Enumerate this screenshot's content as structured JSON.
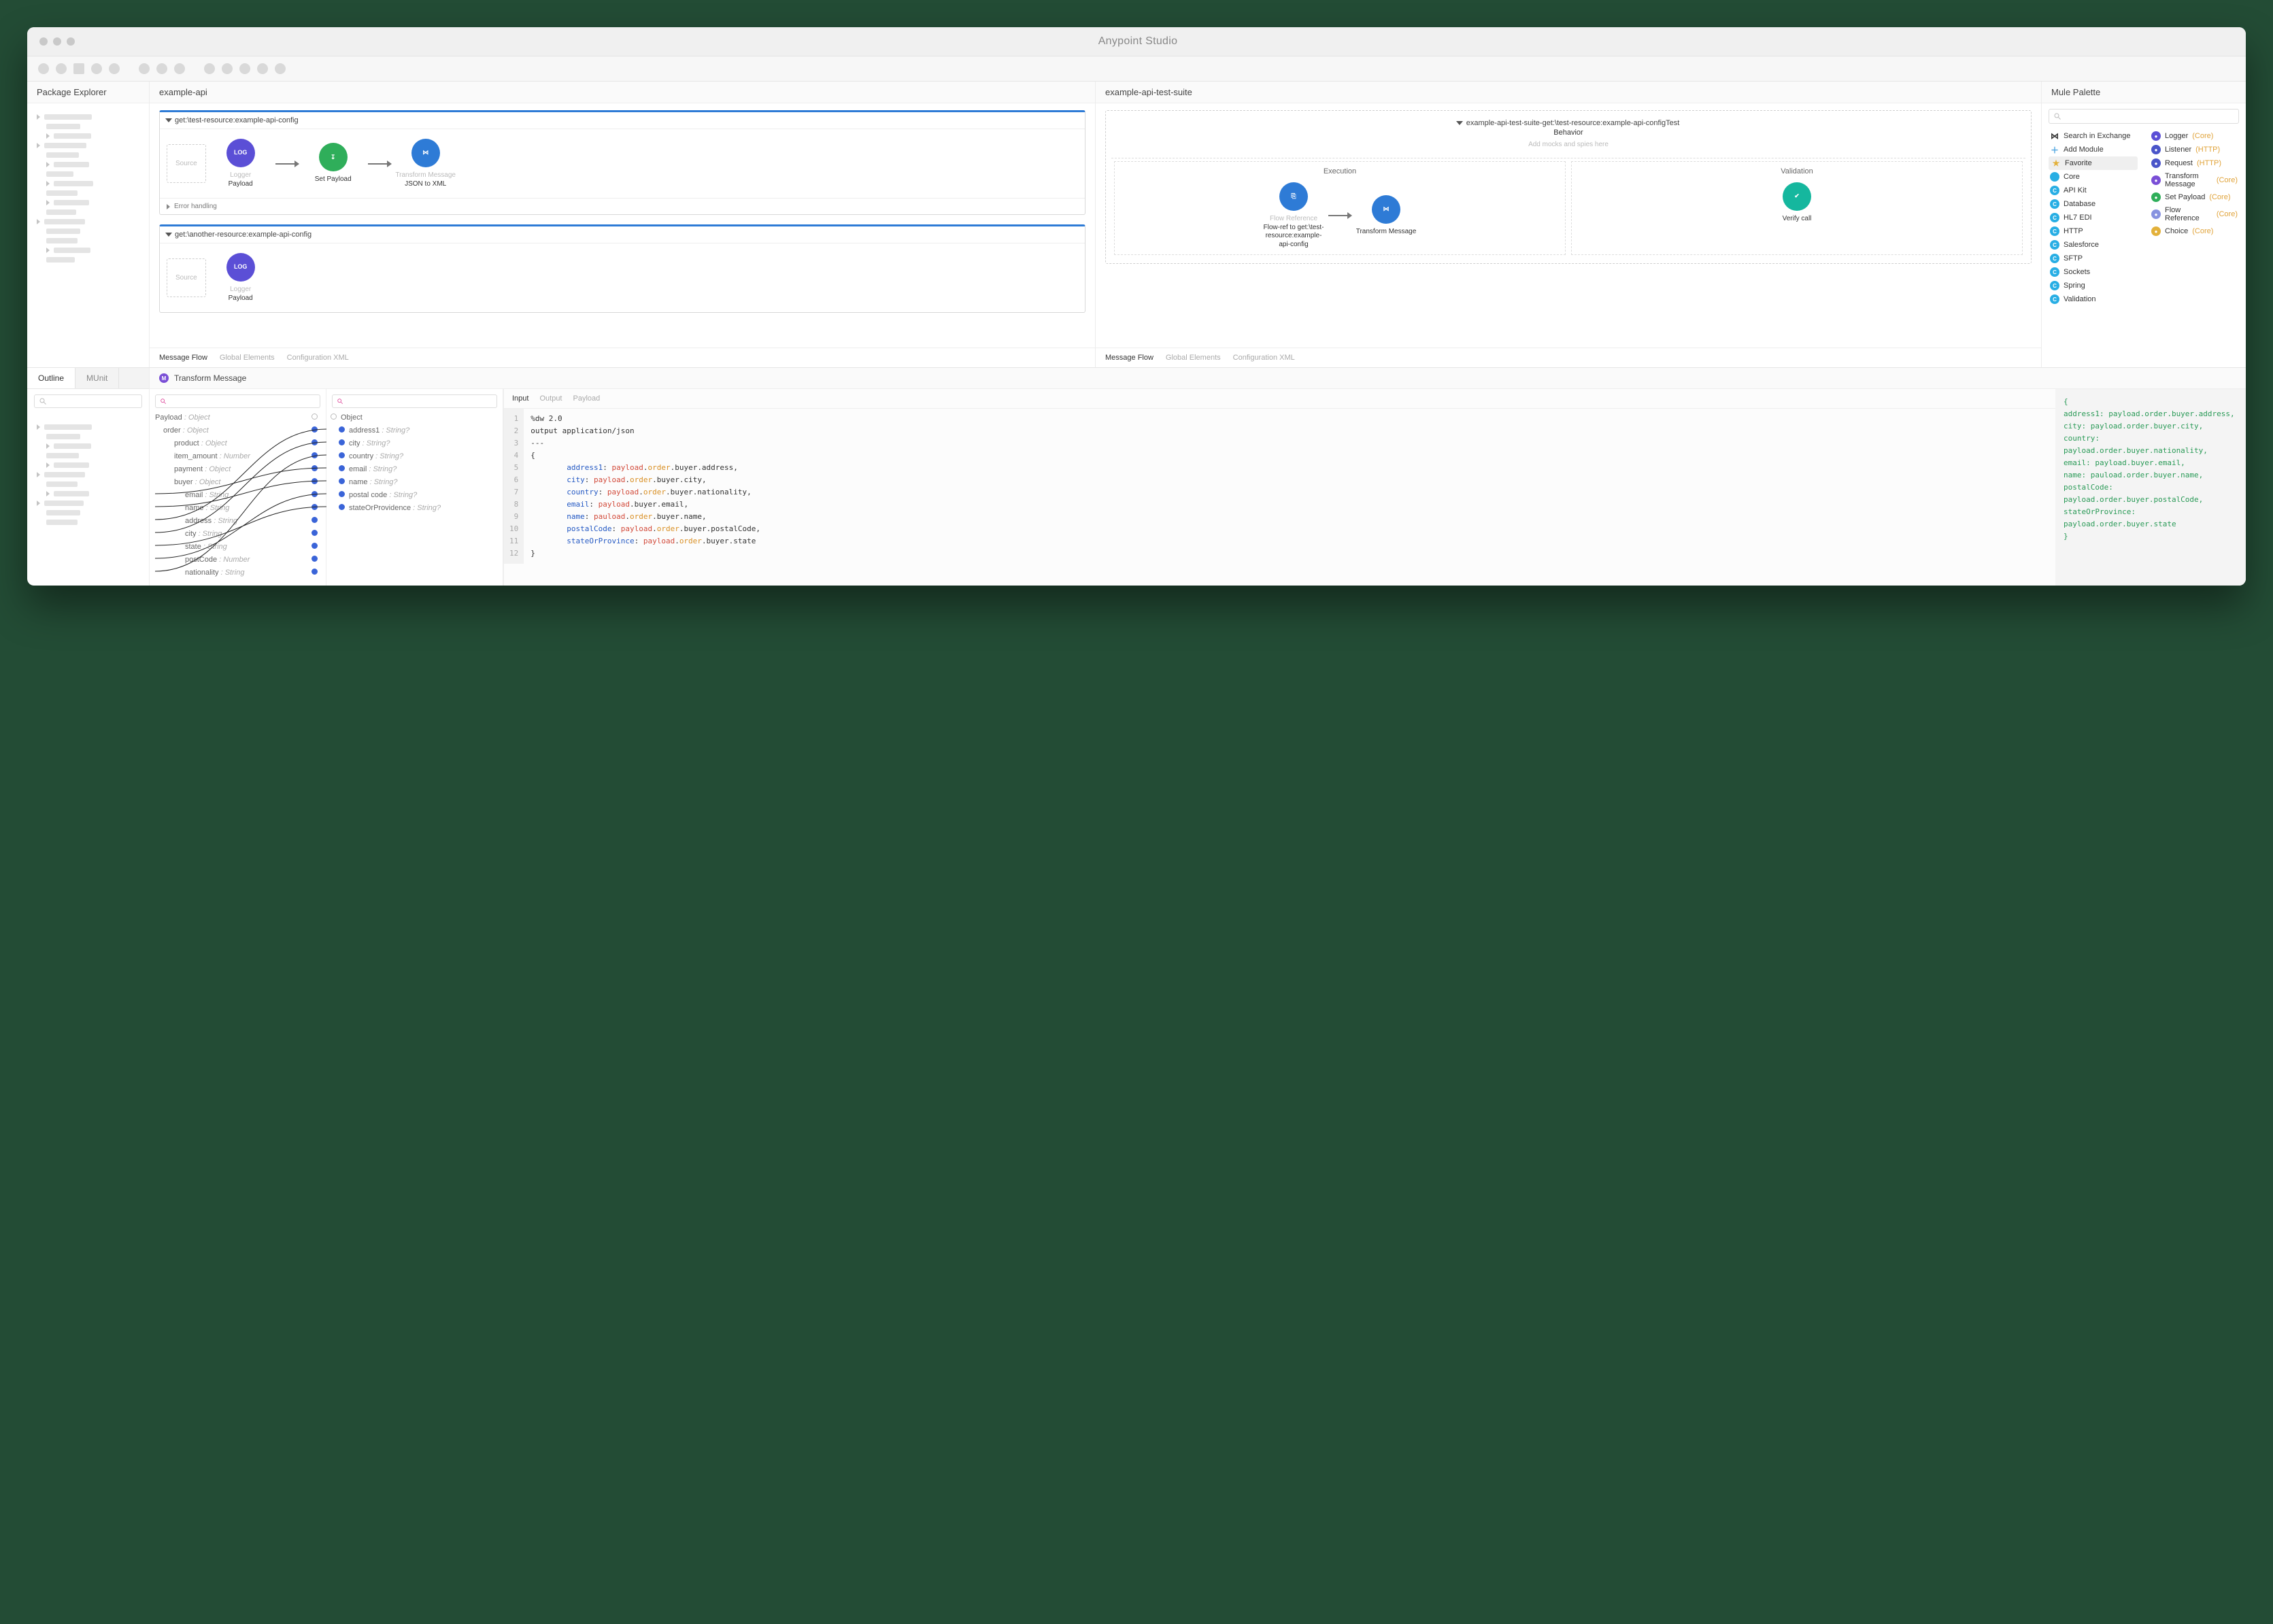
{
  "app": {
    "title": "Anypoint Studio"
  },
  "packageExplorer": {
    "title": "Package Explorer"
  },
  "editor1": {
    "tab": "example-api",
    "flow1": {
      "name": "get:\\test-resource:example-api-config",
      "source": "Source",
      "n1_title": "Logger",
      "n1_sub": "Payload",
      "n2_title": "Set Payload",
      "n2_sub": "",
      "n3_title": "Transform Message",
      "n3_sub": "JSON to XML",
      "errorHandling": "Error handling"
    },
    "flow2": {
      "name": "get:\\another-resource:example-api-config",
      "source": "Source",
      "n1_title": "Logger",
      "n1_sub": "Payload"
    },
    "tabs": {
      "t1": "Message Flow",
      "t2": "Global Elements",
      "t3": "Configuration XML"
    }
  },
  "editor2": {
    "tab": "example-api-test-suite",
    "test": {
      "name": "example-api-test-suite-get:\\test-resource:example-api-configTest",
      "behavior": "Behavior",
      "hint": "Add mocks and spies here",
      "exec": "Execution",
      "valid": "Validation",
      "n1_title": "Flow Reference",
      "n1_sub": "Flow-ref to get:\\test-resource:example-api-config",
      "n2_title": "Transform Message",
      "n3_title": "Verify call"
    },
    "tabs": {
      "t1": "Message Flow",
      "t2": "Global Elements",
      "t3": "Configuration XML"
    }
  },
  "palette": {
    "title": "Mule Palette",
    "left": [
      {
        "icon": "exchange",
        "label": "Search in Exchange"
      },
      {
        "icon": "plus",
        "label": "Add Module"
      },
      {
        "icon": "star",
        "label": "Favorite",
        "fav": true
      },
      {
        "icon": "core",
        "label": "Core"
      },
      {
        "icon": "apikit",
        "label": "API Kit"
      },
      {
        "icon": "db",
        "label": "Database"
      },
      {
        "icon": "hl7",
        "label": "HL7 EDI"
      },
      {
        "icon": "http",
        "label": "HTTP"
      },
      {
        "icon": "sf",
        "label": "Salesforce"
      },
      {
        "icon": "sftp",
        "label": "SFTP"
      },
      {
        "icon": "sock",
        "label": "Sockets"
      },
      {
        "icon": "spring",
        "label": "Spring"
      },
      {
        "icon": "val",
        "label": "Validation"
      }
    ],
    "right": [
      {
        "color": "#5b4fd6",
        "label": "Logger",
        "tag": "(Core)"
      },
      {
        "color": "#4a55c9",
        "label": "Listener",
        "tag": "(HTTP)"
      },
      {
        "color": "#4a55c9",
        "label": "Request",
        "tag": "(HTTP)"
      },
      {
        "color": "#7a4fd6",
        "label": "Transform Message",
        "tag": "(Core)"
      },
      {
        "color": "#2fae5a",
        "label": "Set Payload",
        "tag": "(Core)"
      },
      {
        "color": "#8893e0",
        "label": "Flow Reference",
        "tag": "(Core)"
      },
      {
        "color": "#e3b13b",
        "label": "Choice",
        "tag": "(Core)"
      }
    ]
  },
  "outline": {
    "tab1": "Outline",
    "tab2": "MUnit"
  },
  "trans": {
    "title": "Transform Message",
    "left": [
      {
        "ind": 0,
        "label": "Payload",
        "ty": "Object"
      },
      {
        "ind": 1,
        "label": "order",
        "ty": "Object"
      },
      {
        "ind": 2,
        "label": "product",
        "ty": "Object"
      },
      {
        "ind": 2,
        "label": "item_amount",
        "ty": "Number"
      },
      {
        "ind": 2,
        "label": "payment",
        "ty": "Object"
      },
      {
        "ind": 2,
        "label": "buyer",
        "ty": "Object"
      },
      {
        "ind": 3,
        "label": "email",
        "ty": "String"
      },
      {
        "ind": 3,
        "label": "name",
        "ty": "String"
      },
      {
        "ind": 3,
        "label": "address",
        "ty": "String"
      },
      {
        "ind": 3,
        "label": "city",
        "ty": "String"
      },
      {
        "ind": 3,
        "label": "state",
        "ty": "String"
      },
      {
        "ind": 3,
        "label": "postCode",
        "ty": "Number"
      },
      {
        "ind": 3,
        "label": "nationality",
        "ty": "String"
      }
    ],
    "right": [
      {
        "ind": 0,
        "label": "Object",
        "ty": ""
      },
      {
        "ind": 1,
        "label": "address1",
        "ty": "String?"
      },
      {
        "ind": 1,
        "label": "city",
        "ty": "String?"
      },
      {
        "ind": 1,
        "label": "country",
        "ty": "String?"
      },
      {
        "ind": 1,
        "label": "email",
        "ty": "String?"
      },
      {
        "ind": 1,
        "label": "name",
        "ty": "String?"
      },
      {
        "ind": 1,
        "label": "postal code",
        "ty": "String?"
      },
      {
        "ind": 1,
        "label": "stateOrProvidence",
        "ty": "String?"
      }
    ],
    "codeTabs": {
      "t1": "Input",
      "t2": "Output",
      "t3": "Payload"
    },
    "code": [
      "%dw 2.0",
      "output application/json",
      "---",
      "{",
      "        address1: payload.order.buyer.address,",
      "        city: payload.order.buyer.city,",
      "        country: payload.order.buyer.nationality,",
      "        email: payload.buyer.email,",
      "        name: pauload.order.buyer.name,",
      "        postalCode: payload.order.buyer.postalCode,",
      "        stateOrProvince: payload.order.buyer.state",
      "}"
    ],
    "json": [
      "{",
      "  address1: payload.order.buyer.address,",
      "  city: payload.order.buyer.city,",
      "  country: payload.order.buyer.nationality,",
      "  email: payload.buyer.email,",
      "  name: pauload.order.buyer.name,",
      "  postalCode: payload.order.buyer.postalCode,",
      "  stateOrProvince: payload.order.buyer.state",
      "}"
    ]
  }
}
